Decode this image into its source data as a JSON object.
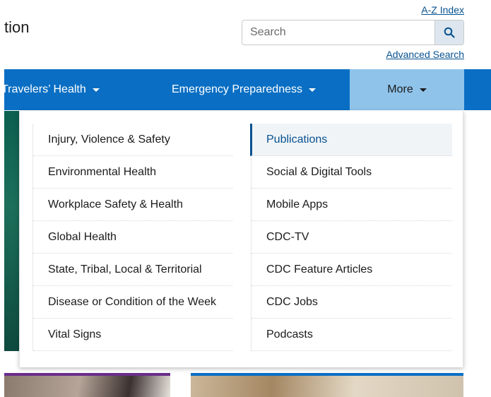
{
  "header": {
    "logo_partial": "tion",
    "az_index": "A-Z Index",
    "search_placeholder": "Search",
    "advanced_search": "Advanced Search"
  },
  "nav": {
    "items": [
      {
        "label": "Travelers’ Health"
      },
      {
        "label": "Emergency Preparedness"
      },
      {
        "label": "More"
      }
    ]
  },
  "dropdown": {
    "left_items": [
      "Injury, Violence & Safety",
      "Environmental Health",
      "Workplace Safety & Health",
      "Global Health",
      "State, Tribal, Local & Territorial",
      "Disease or Condition of the Week",
      "Vital Signs"
    ],
    "right_items": [
      "Publications",
      "Social & Digital Tools",
      "Mobile Apps",
      "CDC-TV",
      "CDC Feature Articles",
      "CDC Jobs",
      "Podcasts"
    ],
    "active_item": "Publications"
  },
  "colors": {
    "nav_bg": "#0a6fc4",
    "nav_active_bg": "#8fc3ea",
    "link": "#075290"
  },
  "icons": {
    "search": "search-icon",
    "caret": "caret-down-icon"
  }
}
